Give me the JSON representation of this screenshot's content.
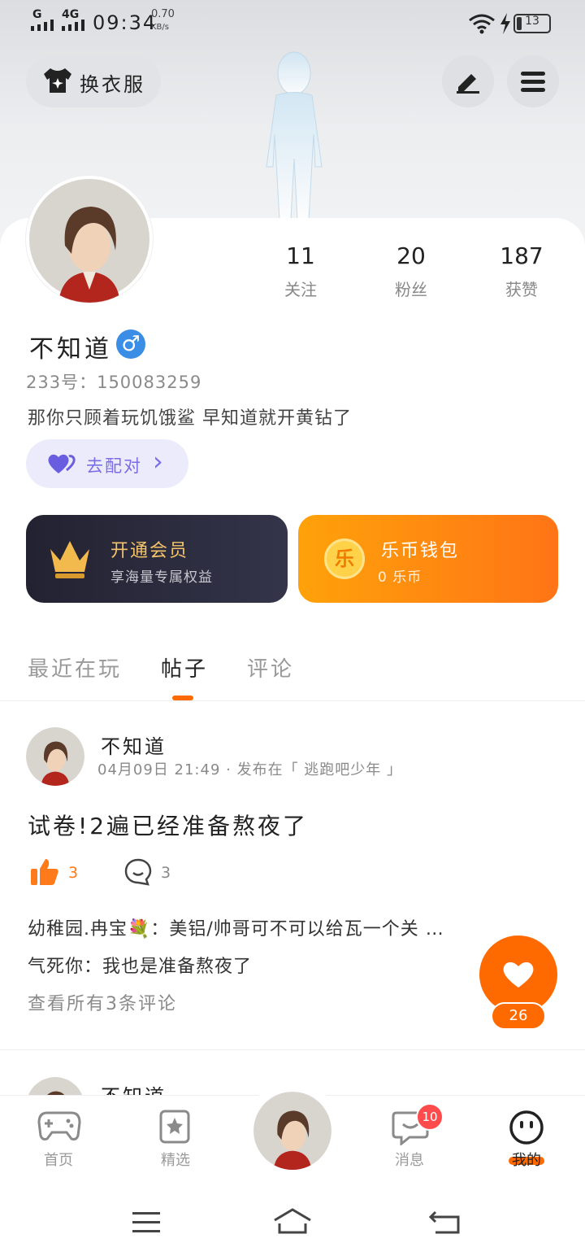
{
  "status_bar": {
    "signal1": "G",
    "signal2": "4G",
    "time": "09:34",
    "speed_value": "0.70",
    "speed_unit": "KB/s",
    "battery": "13"
  },
  "header": {
    "outfit_label": "换衣服",
    "edit_icon": "pen-icon",
    "menu_icon": "menu-icon"
  },
  "profile": {
    "stats": [
      {
        "num": "11",
        "label": "关注"
      },
      {
        "num": "20",
        "label": "粉丝"
      },
      {
        "num": "187",
        "label": "获赞"
      }
    ],
    "name": "不知道",
    "gender_symbol": "♂",
    "id_line": "233号：150083259",
    "bio": "那你只顾着玩饥饿鲨 早知道就开黄钻了",
    "match_label": "去配对",
    "match_arrow": "›"
  },
  "promo": {
    "vip_title": "开通会员",
    "vip_sub": "享海量专属权益",
    "wallet_title": "乐币钱包",
    "wallet_sub": "0 乐币",
    "coin_char": "乐"
  },
  "tabs": [
    {
      "label": "最近在玩"
    },
    {
      "label": "帖子"
    },
    {
      "label": "评论"
    }
  ],
  "post": {
    "author": "不知道",
    "meta": "04月09日 21:49 · 发布在「 逃跑吧少年 」",
    "content": "试卷!2遍已经准备熬夜了",
    "likes": "3",
    "comments": "3",
    "comment1": "幼稚园.冉宝💐：美铝/帅哥可不可以给瓦一个关 …",
    "comment2": "气死你：我也是准备熬夜了",
    "view_all": "查看所有3条评论"
  },
  "post2": {
    "author": "不知道"
  },
  "fab": {
    "count": "26"
  },
  "nav": {
    "items": [
      {
        "label": "首页"
      },
      {
        "label": "精选"
      },
      {
        "label": "消息"
      },
      {
        "label": "我的"
      }
    ],
    "badge": "10"
  },
  "colors": {
    "accent": "#ff6a00",
    "purple": "#7a6ee8",
    "dark_card": "#2a2a3c"
  }
}
